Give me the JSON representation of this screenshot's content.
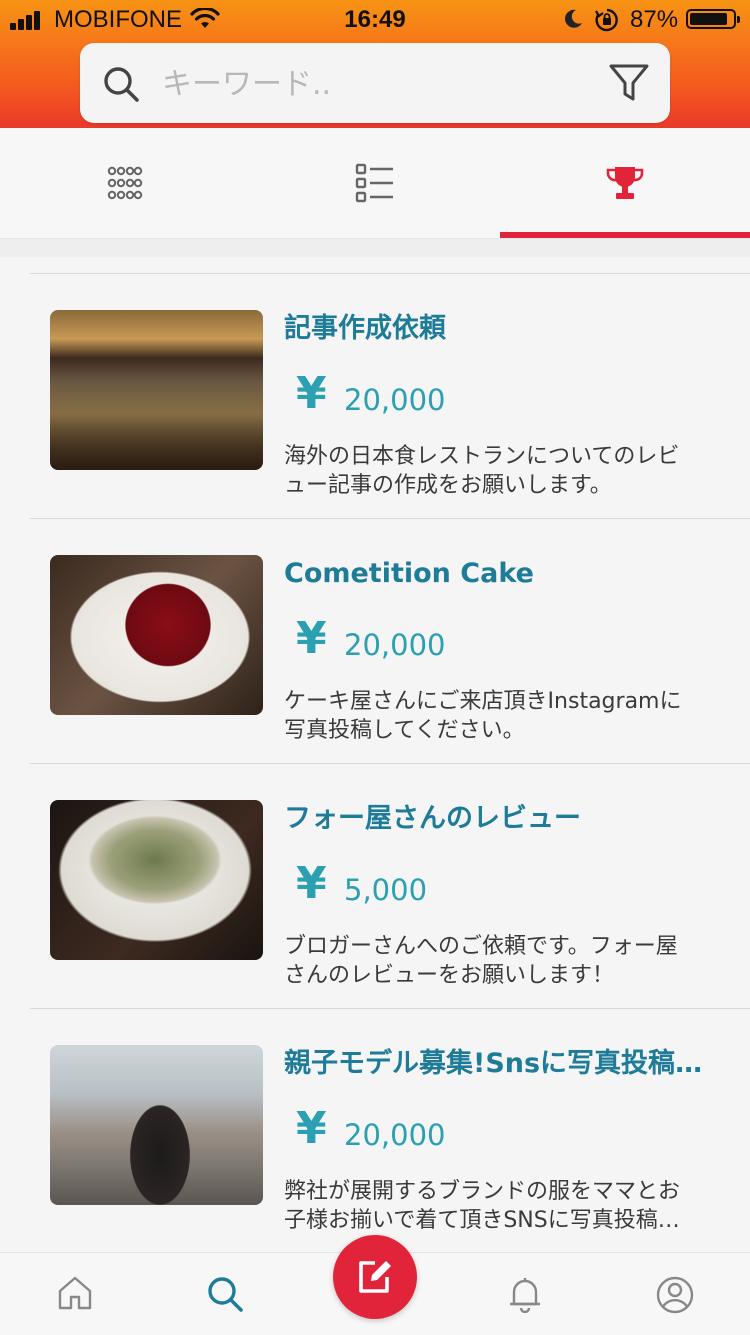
{
  "status_bar": {
    "carrier": "MOBIFONE",
    "time": "16:49",
    "battery_percent": "87%",
    "battery_level": 0.87
  },
  "search": {
    "placeholder": "キーワード..",
    "value": ""
  },
  "tabs": {
    "items": [
      {
        "name": "grid-view",
        "icon": "grid-dots-icon",
        "active": false
      },
      {
        "name": "list-view",
        "icon": "checklist-icon",
        "active": false
      },
      {
        "name": "ranking",
        "icon": "trophy-icon",
        "active": true
      }
    ]
  },
  "colors": {
    "accent": "#e2243b",
    "title": "#1e7c99",
    "price": "#2aa0b2",
    "header_top": "#f79414",
    "header_bottom": "#e9392a"
  },
  "jobs": [
    {
      "title": "記事作成依頼",
      "currency": "¥",
      "price": "20,000",
      "description": "海外の日本食レストランについてのレビュー記事の作成をお願いします。"
    },
    {
      "title": "Cometition Cake",
      "currency": "¥",
      "price": "20,000",
      "description": "ケーキ屋さんにご来店頂きInstagramに写真投稿してください。"
    },
    {
      "title": "フォー屋さんのレビュー",
      "currency": "¥",
      "price": "5,000",
      "description": "ブロガーさんへのご依頼です。フォー屋さんのレビューをお願いします！"
    },
    {
      "title": "親子モデル募集!Snsに写真投稿してくれる方",
      "currency": "¥",
      "price": "20,000",
      "description": "弊社が展開するブランドの服をママとお子様お揃いで着て頂きSNSに写真投稿してください。"
    }
  ],
  "bottom_nav": {
    "items": [
      {
        "icon": "home-icon"
      },
      {
        "icon": "search-icon",
        "active": true
      },
      {
        "icon": "compose-icon"
      },
      {
        "icon": "bell-icon"
      },
      {
        "icon": "user-circle-icon"
      }
    ]
  }
}
